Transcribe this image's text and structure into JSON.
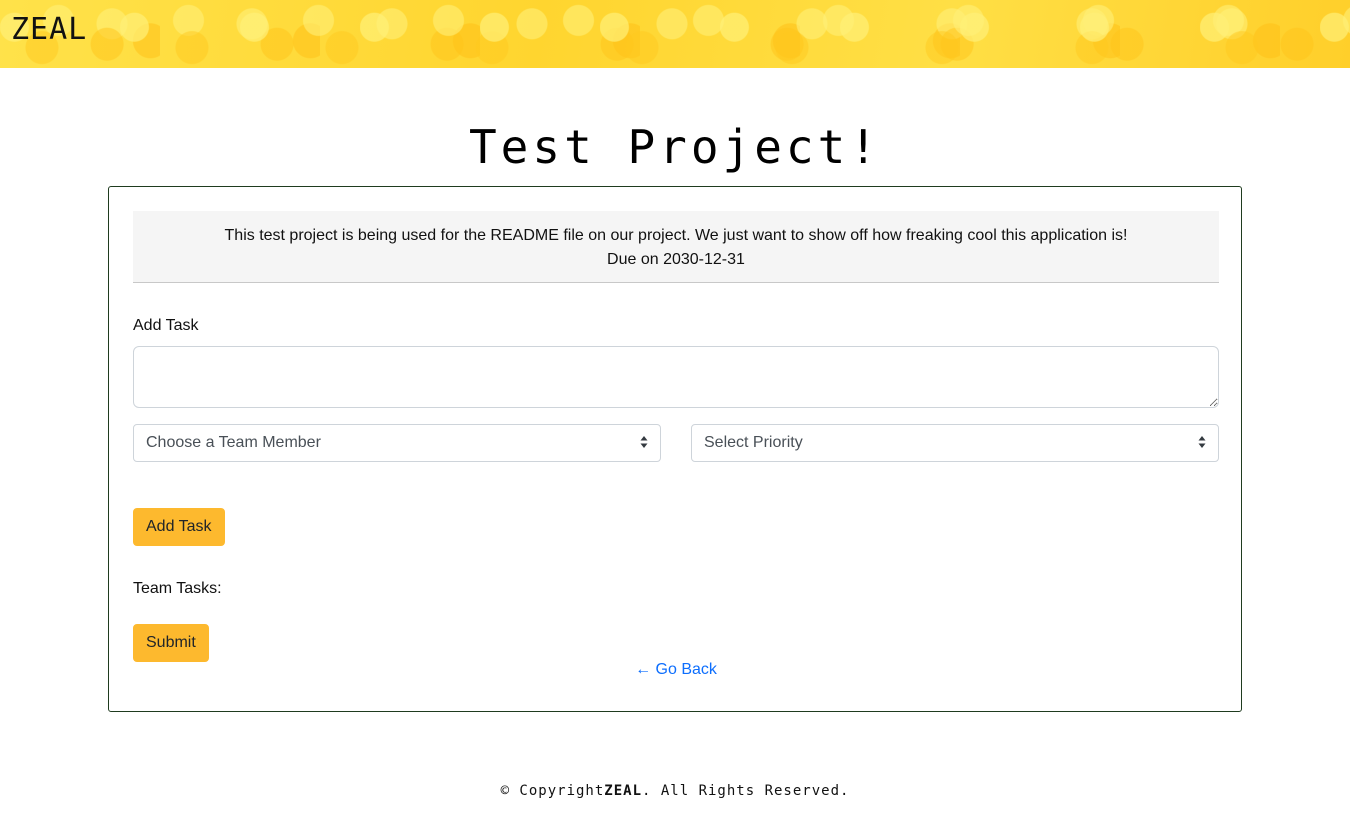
{
  "header": {
    "brand": "ZEAL"
  },
  "project": {
    "title": "Test Project!",
    "description": "This test project is being used for the README file on our project. We just want to show off how freaking cool this application is!",
    "due": "Due on 2030-12-31"
  },
  "form": {
    "add_task_label": "Add Task",
    "task_value": "",
    "team_member_select": "Choose a Team Member",
    "priority_select": "Select Priority",
    "add_task_button": "Add Task",
    "team_tasks_label": "Team Tasks:",
    "submit_button": "Submit",
    "go_back_link": "← Go Back"
  },
  "footer": {
    "prefix": "© Copyright",
    "brand": "ZEAL",
    "suffix": ". All Rights Reserved."
  },
  "colors": {
    "accent_button": "#fdb92e",
    "link": "#0d6efd",
    "header_bg": "#ffd83a"
  }
}
